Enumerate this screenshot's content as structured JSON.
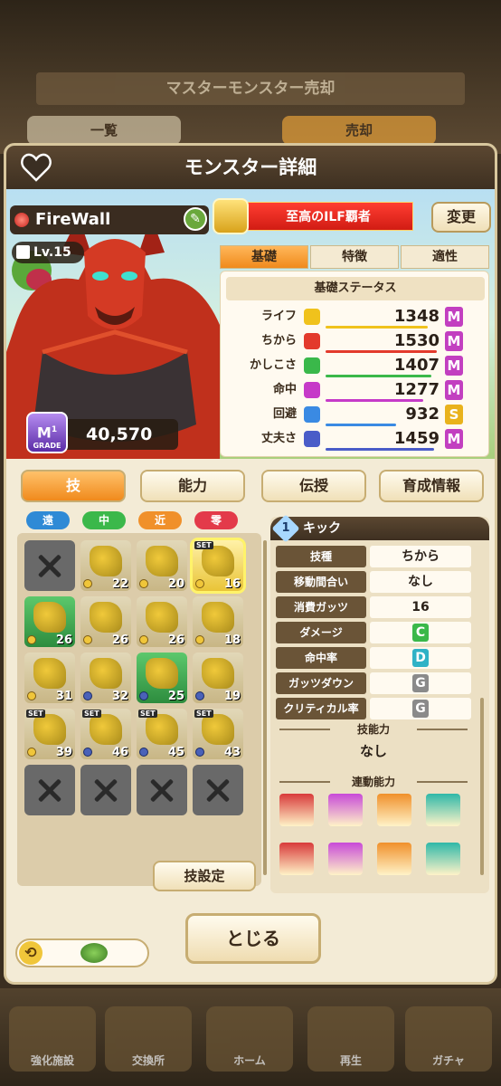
{
  "background": {
    "screen_title": "マスターモンスター売却",
    "tabs": [
      "一覧",
      "売却"
    ],
    "nav": [
      "強化施設",
      "交換所",
      "ホーム",
      "再生",
      "ガチャ"
    ]
  },
  "dialog": {
    "title": "モンスター詳細",
    "monster_name": "FireWall",
    "level": "Lv.15",
    "grade": "M",
    "grade_sub": "1",
    "grade_label": "GRADE",
    "score": "40,570",
    "title_badge": "至高のILF覇者",
    "change_label": "変更"
  },
  "status": {
    "tabs": [
      "基礎",
      "特徴",
      "適性"
    ],
    "header": "基礎ステータス",
    "rows": [
      {
        "label": "ライフ",
        "value": "1348",
        "rank": "M",
        "color": "#f0c21c",
        "rank_color": "#c23fc0",
        "fill": 0.9
      },
      {
        "label": "ちから",
        "value": "1530",
        "rank": "M",
        "color": "#e33a2c",
        "rank_color": "#c23fc0",
        "fill": 0.98
      },
      {
        "label": "かしこさ",
        "value": "1407",
        "rank": "M",
        "color": "#3ab84a",
        "rank_color": "#c23fc0",
        "fill": 0.93
      },
      {
        "label": "命中",
        "value": "1277",
        "rank": "M",
        "color": "#c63ac8",
        "rank_color": "#c23fc0",
        "fill": 0.86
      },
      {
        "label": "回避",
        "value": "932",
        "rank": "S",
        "color": "#3a8ae3",
        "rank_color": "#e9b21c",
        "fill": 0.62
      },
      {
        "label": "丈夫さ",
        "value": "1459",
        "rank": "M",
        "color": "#4a5cc8",
        "rank_color": "#c23fc0",
        "fill": 0.95
      }
    ]
  },
  "main_tabs": [
    "技",
    "能力",
    "伝授",
    "育成情報"
  ],
  "range_chips": [
    {
      "label": "遠",
      "color": "#2f8ad6"
    },
    {
      "label": "中",
      "color": "#3bb84a"
    },
    {
      "label": "近",
      "color": "#f0902a"
    },
    {
      "label": "零",
      "color": "#e33a4a"
    }
  ],
  "skills": [
    {
      "type": "x",
      "num": ""
    },
    {
      "type": "skill",
      "num": "22"
    },
    {
      "type": "skill",
      "num": "20"
    },
    {
      "type": "gold",
      "num": "16",
      "set": "SET",
      "selected": true
    },
    {
      "type": "green",
      "num": "26"
    },
    {
      "type": "skill",
      "num": "26"
    },
    {
      "type": "skill",
      "num": "26"
    },
    {
      "type": "skill",
      "num": "18"
    },
    {
      "type": "skill",
      "num": "31"
    },
    {
      "type": "skill",
      "num": "32"
    },
    {
      "type": "green",
      "num": "25"
    },
    {
      "type": "skill",
      "num": "19"
    },
    {
      "type": "skill",
      "num": "39",
      "set": "SET"
    },
    {
      "type": "skill",
      "num": "46",
      "set": "SET"
    },
    {
      "type": "skill",
      "num": "45",
      "set": "SET"
    },
    {
      "type": "skill",
      "num": "43",
      "set": "SET"
    },
    {
      "type": "x",
      "num": ""
    },
    {
      "type": "x",
      "num": ""
    },
    {
      "type": "x",
      "num": ""
    },
    {
      "type": "x",
      "num": ""
    }
  ],
  "skill_setting_label": "技設定",
  "detail": {
    "index": "1",
    "name": "キック",
    "rows": [
      {
        "label": "技種",
        "value": "ちから"
      },
      {
        "label": "移動間合い",
        "value": "なし"
      },
      {
        "label": "消費ガッツ",
        "value": "16"
      },
      {
        "label": "ダメージ",
        "value": "C",
        "rank_color": "#3ab84a"
      },
      {
        "label": "命中率",
        "value": "D",
        "rank_color": "#2fb2c6"
      },
      {
        "label": "ガッツダウン",
        "value": "G",
        "rank_color": "#8a8a8a"
      },
      {
        "label": "クリティカル率",
        "value": "G",
        "rank_color": "#8a8a8a"
      }
    ],
    "skill_ability_label": "技能力",
    "skill_ability_value": "なし",
    "linked_label": "連動能力"
  },
  "close_label": "とじる"
}
